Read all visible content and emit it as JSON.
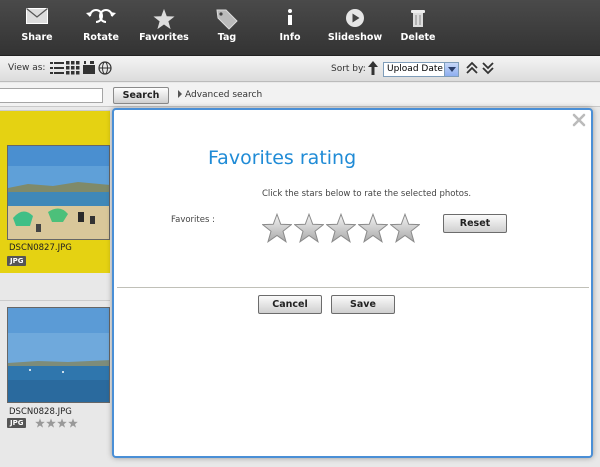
{
  "toolbar": {
    "items": [
      {
        "label": "Share",
        "icon": "envelope-icon"
      },
      {
        "label": "Rotate",
        "icon": "rotate-icon"
      },
      {
        "label": "Favorites",
        "icon": "star-icon"
      },
      {
        "label": "Tag",
        "icon": "tag-icon"
      },
      {
        "label": "Info",
        "icon": "info-icon"
      },
      {
        "label": "Slideshow",
        "icon": "play-icon"
      },
      {
        "label": "Delete",
        "icon": "trash-icon"
      }
    ]
  },
  "viewbar": {
    "view_as_label": "View as:",
    "sort_by_label": "Sort by:",
    "sort_value": "Upload Date"
  },
  "searchbar": {
    "search_button": "Search",
    "advanced_search": "Advanced search"
  },
  "photos": [
    {
      "filename": "DSCN0827.JPG",
      "type": "JPG",
      "selected": true,
      "rating": 0
    },
    {
      "filename": "DSCN0828.JPG",
      "type": "JPG",
      "selected": false,
      "rating": 4
    }
  ],
  "dialog": {
    "title": "Favorites rating",
    "instruction": "Click the stars below to rate the selected photos.",
    "favorites_label": "Favorites :",
    "rating": 0,
    "max_rating": 5,
    "reset_button": "Reset",
    "cancel_button": "Cancel",
    "save_button": "Save"
  },
  "colors": {
    "accent": "#1f8bd6",
    "selection": "#e5d212",
    "dialog_border": "#4a8fd6"
  }
}
